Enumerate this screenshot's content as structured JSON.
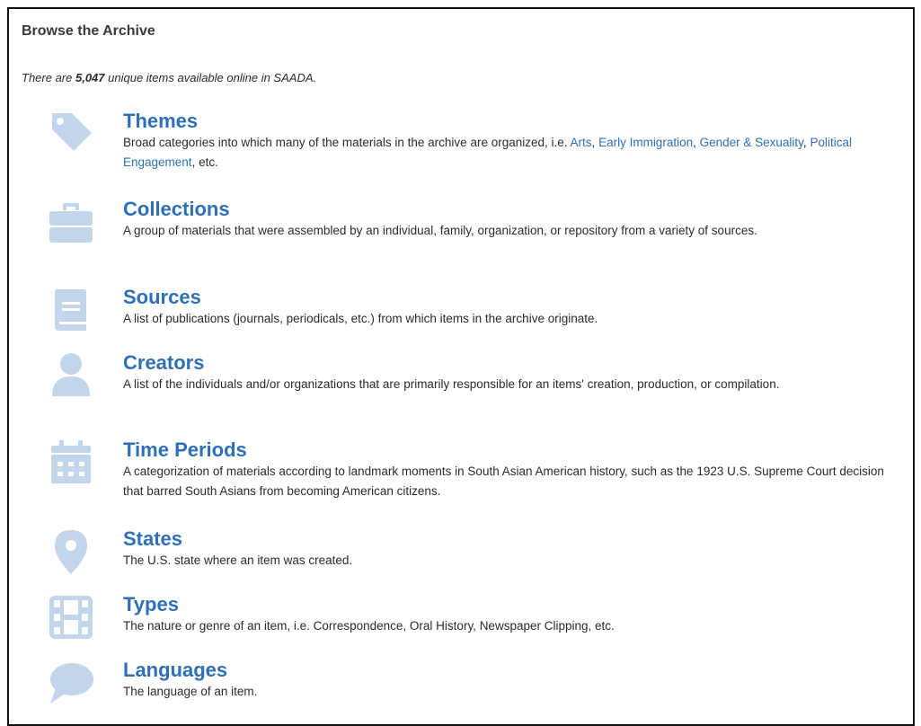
{
  "page": {
    "title": "Browse the Archive",
    "intro_prefix": "There are ",
    "intro_count": "5,047",
    "intro_suffix": " unique items available online in SAADA."
  },
  "categories": [
    {
      "title": "Themes",
      "icon": "tag-icon",
      "desc_prefix": "Broad categories into which many of the materials in the archive are organized, i.e. ",
      "links": [
        "Arts",
        "Early Immigration",
        "Gender & Sexuality",
        "Political Engagement"
      ],
      "separators": [
        ", ",
        ", ",
        ", "
      ],
      "desc_suffix": ", etc."
    },
    {
      "title": "Collections",
      "icon": "briefcase-icon",
      "desc": "A group of materials that were assembled by an individual, family, organization, or repository from a variety of sources."
    },
    {
      "title": "Sources",
      "icon": "book-icon",
      "desc": "A list of publications (journals, periodicals, etc.) from which items in the archive originate."
    },
    {
      "title": "Creators",
      "icon": "user-icon",
      "desc": "A list of the individuals and/or organizations that are primarily responsible for an items' creation, production, or compilation."
    },
    {
      "title": "Time Periods",
      "icon": "calendar-icon",
      "desc": "A categorization of materials according to landmark moments in South Asian American history, such as the 1923 U.S. Supreme Court decision that barred South Asians from becoming American citizens."
    },
    {
      "title": "States",
      "icon": "map-pin-icon",
      "desc": "The U.S. state where an item was created."
    },
    {
      "title": "Types",
      "icon": "film-icon",
      "desc": "The nature or genre of an item, i.e. Correspondence, Oral History, Newspaper Clipping, etc."
    },
    {
      "title": "Languages",
      "icon": "speech-bubble-icon",
      "desc": "The language of an item."
    }
  ],
  "colors": {
    "link": "#2f6fb7",
    "icon": "#c3d5eb",
    "text": "#2b2b2b"
  }
}
